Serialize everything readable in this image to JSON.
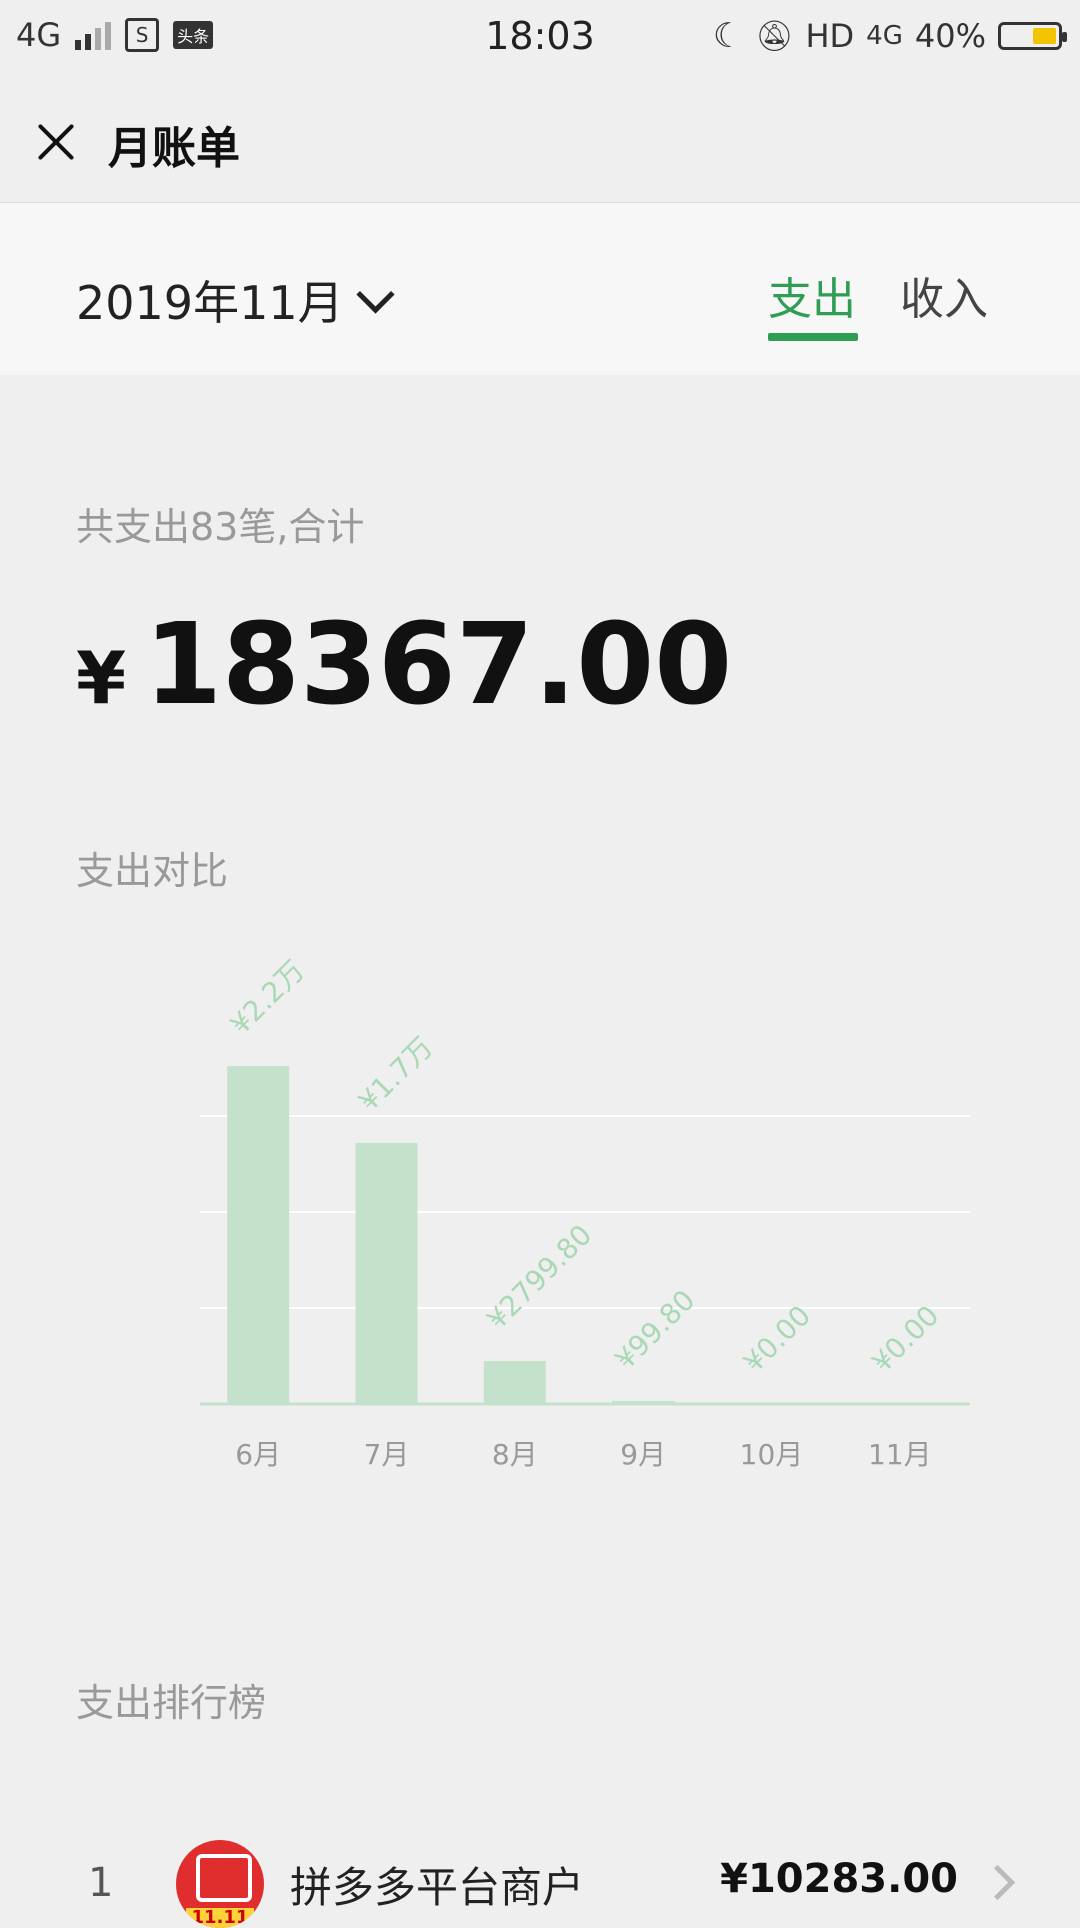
{
  "status_bar": {
    "network_left": "4G",
    "time": "18:03",
    "hd": "HD",
    "network_right": "4G",
    "battery": "40%",
    "news_badge": "头条",
    "box_badge": "S"
  },
  "nav": {
    "title": "月账单"
  },
  "filter": {
    "month": "2019年11月",
    "tabs": [
      "支出",
      "收入"
    ],
    "active_tab": "支出"
  },
  "summary": {
    "label": "共支出83笔,合计",
    "currency": "¥",
    "amount": "18367.00"
  },
  "sections": {
    "comparison_title": "支出对比",
    "ranking_title": "支出排行榜"
  },
  "chart_data": {
    "type": "bar",
    "categories": [
      "6月",
      "7月",
      "8月",
      "9月",
      "10月",
      "11月"
    ],
    "values": [
      22000,
      17000,
      2799.8,
      99.8,
      0,
      0
    ],
    "data_labels": [
      "¥2.2万",
      "¥1.7万",
      "¥2799.80",
      "¥99.80",
      "¥0.00",
      "¥0.00"
    ],
    "ylim": [
      0,
      25000
    ],
    "grid": true,
    "colors": {
      "bar": "#c4e2cb",
      "label": "#a9d8b4",
      "axis_text": "#999999"
    }
  },
  "ranking": [
    {
      "rank": "1",
      "name": "拼多多平台商户",
      "amount": "¥10283.00",
      "logo_tag": "11.11"
    }
  ],
  "colors": {
    "accent": "#2f9e55",
    "background": "#efefef"
  }
}
